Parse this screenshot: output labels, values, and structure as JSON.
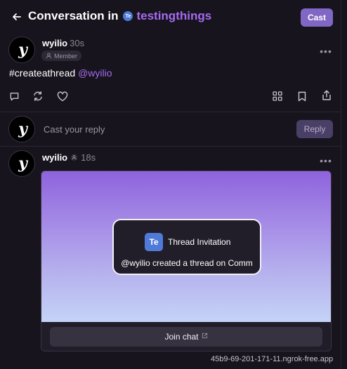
{
  "header": {
    "title_prefix": "Conversation in",
    "channel_badge": "Te",
    "channel_name": "testingthings",
    "cast_button": "Cast"
  },
  "main_cast": {
    "author": "wyilio",
    "time": "30s",
    "role": "Member",
    "text_hashtag": "#createathread",
    "text_mention": "@wyilio"
  },
  "composer": {
    "placeholder": "Cast your reply",
    "reply_button": "Reply"
  },
  "reply_cast": {
    "author": "wyilio",
    "time": "18s"
  },
  "embed": {
    "avatar_initials": "Te",
    "title": "Thread Invitation",
    "description": "@wyilio created a thread on Comm",
    "join_button": "Join chat"
  },
  "status_bar": {
    "url": "45b9-69-201-171-11.ngrok-free.app"
  },
  "colors": {
    "background": "#17141d",
    "accent": "#8067c5",
    "mention": "#a66bf0",
    "channel_badge": "#4f7ad8"
  },
  "icons": [
    "back-arrow-icon",
    "more-horizontal-icon",
    "comment-icon",
    "recast-icon",
    "heart-icon",
    "grid-icon",
    "bookmark-icon",
    "share-icon",
    "member-icon",
    "external-link-icon"
  ]
}
